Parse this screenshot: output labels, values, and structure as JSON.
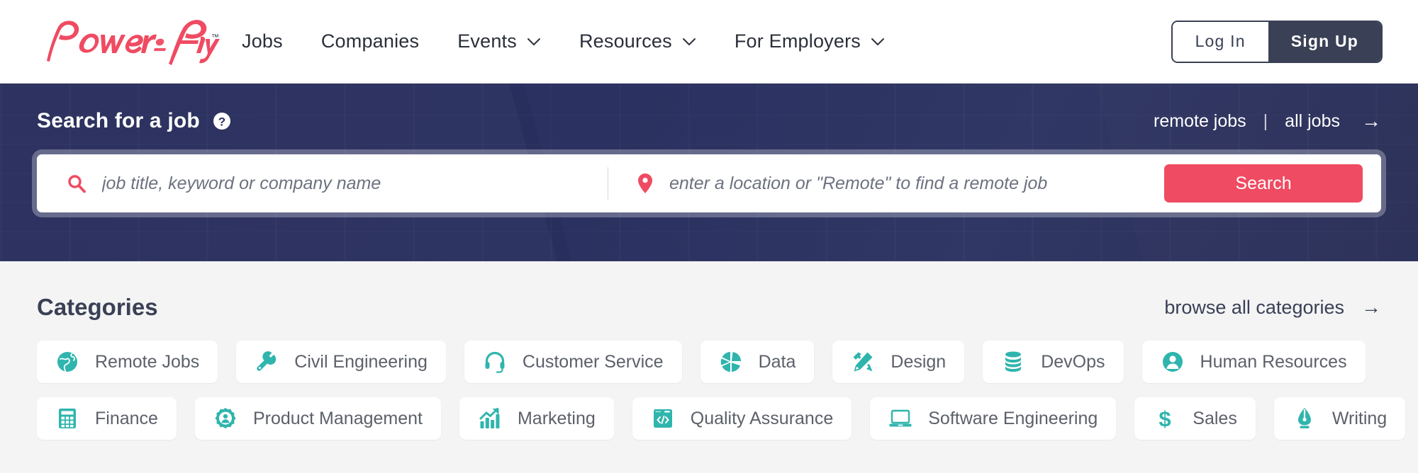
{
  "brand": {
    "logo_text": "PowerToFly",
    "logo_tm": "™",
    "accent_pink": "#ef4b62",
    "navy": "#2b3160",
    "teal": "#2fb5ad",
    "dark_slate": "#3a4055"
  },
  "header": {
    "nav": [
      {
        "label": "Jobs",
        "has_caret": false,
        "icon": ""
      },
      {
        "label": "Companies",
        "has_caret": false,
        "icon": ""
      },
      {
        "label": "Events",
        "has_caret": true,
        "icon": "chevron-down-icon"
      },
      {
        "label": "Resources",
        "has_caret": true,
        "icon": "chevron-down-icon"
      },
      {
        "label": "For Employers",
        "has_caret": true,
        "icon": "chevron-down-icon"
      }
    ],
    "login_label": "Log In",
    "signup_label": "Sign Up"
  },
  "search": {
    "title": "Search for a job",
    "help_icon": "question-mark-circle-icon",
    "links": {
      "remote_jobs": "remote jobs",
      "separator": "|",
      "all_jobs": "all jobs",
      "arrow": "→"
    },
    "keyword": {
      "icon": "search-icon",
      "value": "",
      "placeholder": "job title, keyword or company name"
    },
    "location": {
      "icon": "map-pin-icon",
      "value": "",
      "placeholder": "enter a location or \"Remote\" to find a remote job"
    },
    "button_label": "Search"
  },
  "categories": {
    "title": "Categories",
    "browse_all_label": "browse all categories",
    "browse_all_arrow": "→",
    "rows": [
      [
        {
          "label": "Remote Jobs",
          "icon": "globe-icon"
        },
        {
          "label": "Civil Engineering",
          "icon": "wrench-icon"
        },
        {
          "label": "Customer Service",
          "icon": "headset-icon"
        },
        {
          "label": "Data",
          "icon": "pie-chart-icon"
        },
        {
          "label": "Design",
          "icon": "pen-ruler-icon"
        },
        {
          "label": "DevOps",
          "icon": "database-icon"
        },
        {
          "label": "Human Resources",
          "icon": "user-circle-icon"
        }
      ],
      [
        {
          "label": "Finance",
          "icon": "calculator-icon"
        },
        {
          "label": "Product Management",
          "icon": "gear-user-icon"
        },
        {
          "label": "Marketing",
          "icon": "bar-chart-arrow-icon"
        },
        {
          "label": "Quality Assurance",
          "icon": "code-window-icon"
        },
        {
          "label": "Software Engineering",
          "icon": "laptop-icon"
        },
        {
          "label": "Sales",
          "icon": "dollar-icon"
        },
        {
          "label": "Writing",
          "icon": "fountain-pen-icon"
        }
      ]
    ]
  }
}
